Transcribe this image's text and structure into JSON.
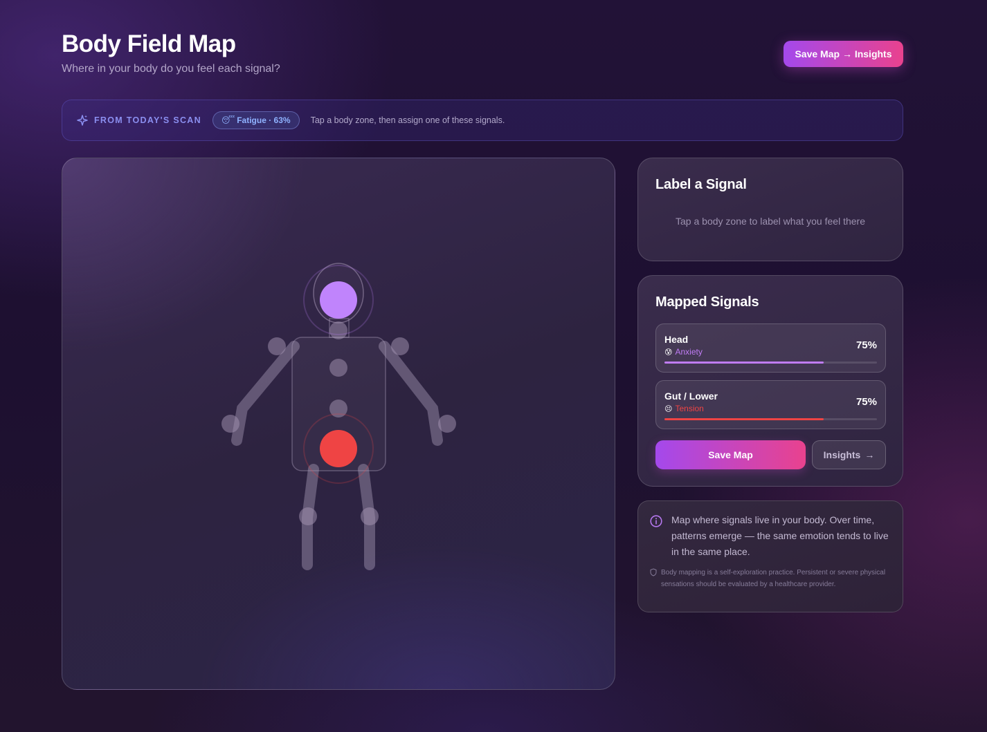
{
  "header": {
    "title": "Body Field Map",
    "subtitle": "Where in your body do you feel each signal?",
    "primary_button": "Save Map → Insights"
  },
  "scan": {
    "label": "FROM TODAY'S SCAN",
    "chip_emoji": "😴",
    "chip_text": "Fatigue · 63%",
    "hint": "Tap a body zone, then assign one of these signals."
  },
  "body_map": {
    "zones": [
      {
        "name": "head",
        "signal": "Anxiety",
        "color": "#c084fc",
        "active": true
      },
      {
        "name": "gut-lower",
        "signal": "Tension",
        "color": "#ef4444",
        "active": true
      }
    ]
  },
  "label_card": {
    "title": "Label a Signal",
    "hint": "Tap a body zone to label what you feel there"
  },
  "mapped_card": {
    "title": "Mapped Signals",
    "signals": [
      {
        "zone": "Head",
        "emoji": "😰",
        "emotion": "Anxiety",
        "percent": "75%",
        "value": 0.75,
        "color": "#c07cf5"
      },
      {
        "zone": "Gut / Lower",
        "emoji": "😣",
        "emotion": "Tension",
        "percent": "75%",
        "value": 0.75,
        "color": "#ef4444"
      }
    ],
    "save_button": "Save Map",
    "insights_button": "Insights",
    "insights_arrow": "→"
  },
  "info_card": {
    "text": "Map where signals live in your body. Over time, patterns emerge — the same emotion tends to live in the same place.",
    "disclaimer": "Body mapping is a self-exploration practice. Persistent or severe physical sensations should be evaluated by a healthcare provider."
  },
  "colors": {
    "accent_start": "#a449ec",
    "accent_end": "#e9428e",
    "scan_label": "#8b8ff0",
    "chip_text": "#8fb2ff"
  }
}
